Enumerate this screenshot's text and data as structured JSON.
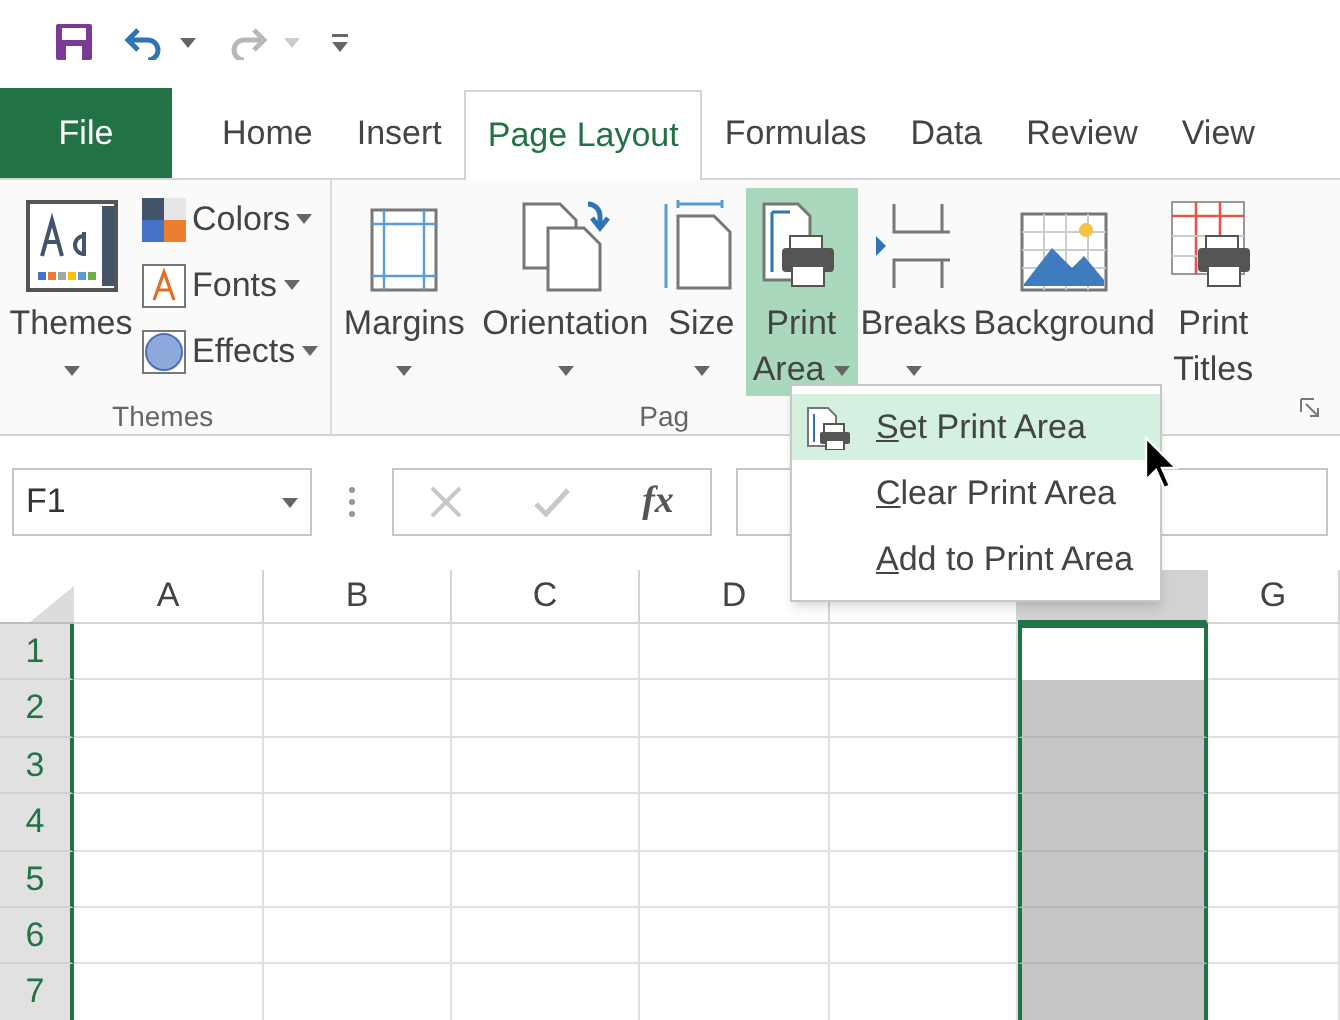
{
  "quick_access": [
    {
      "kind": "save",
      "disabled": false
    },
    {
      "kind": "undo",
      "disabled": false
    },
    {
      "kind": "redo",
      "disabled": true
    },
    {
      "kind": "customize",
      "disabled": false
    }
  ],
  "tabs": [
    {
      "label": "File",
      "kind": "file",
      "selected": false
    },
    {
      "label": "Home",
      "kind": "tab",
      "selected": false
    },
    {
      "label": "Insert",
      "kind": "tab",
      "selected": false
    },
    {
      "label": "Page Layout",
      "kind": "tab",
      "selected": true
    },
    {
      "label": "Formulas",
      "kind": "tab",
      "selected": false
    },
    {
      "label": "Data",
      "kind": "tab",
      "selected": false
    },
    {
      "label": "Review",
      "kind": "tab",
      "selected": false
    },
    {
      "label": "View",
      "kind": "tab",
      "selected": false
    }
  ],
  "ribbon": {
    "groups": [
      {
        "label": "Themes",
        "buttons": [
          {
            "label": "Themes",
            "kind": "large",
            "dropdown": true,
            "selected": false
          },
          {
            "label": "Colors",
            "kind": "small",
            "dropdown": true,
            "selected": false
          },
          {
            "label": "Fonts",
            "kind": "small",
            "dropdown": true,
            "selected": false
          },
          {
            "label": "Effects",
            "kind": "small",
            "dropdown": true,
            "selected": false
          }
        ]
      },
      {
        "label": "Pag",
        "launcher": true,
        "buttons": [
          {
            "label": "Margins",
            "kind": "large",
            "dropdown": true,
            "selected": false
          },
          {
            "label": "Orientation",
            "kind": "large",
            "dropdown": true,
            "selected": false
          },
          {
            "label": "Size",
            "kind": "large",
            "dropdown": true,
            "selected": false
          },
          {
            "label": "Print Area",
            "kind": "large",
            "dropdown": true,
            "selected": true
          },
          {
            "label": "Breaks",
            "kind": "large",
            "dropdown": true,
            "selected": false
          },
          {
            "label": "Background",
            "kind": "large",
            "dropdown": false,
            "selected": false
          },
          {
            "label": "Print Titles",
            "kind": "large",
            "dropdown": false,
            "selected": false
          }
        ]
      }
    ]
  },
  "formula_bar": {
    "name_box": "F1",
    "cancel_disabled": true,
    "enter_disabled": true,
    "function_label": "fx"
  },
  "menu": {
    "items": [
      {
        "label": "Set Print Area",
        "selected": true
      },
      {
        "label": "Clear Print Area",
        "selected": false
      },
      {
        "label": "Add to Print Area",
        "selected": false
      }
    ]
  },
  "sheet": {
    "columns": [
      {
        "label": "A",
        "selected": false
      },
      {
        "label": "B",
        "selected": false
      },
      {
        "label": "C",
        "selected": false
      },
      {
        "label": "D",
        "selected": false
      },
      {
        "selected": false
      },
      {
        "selected": true
      },
      {
        "label": "G",
        "selected": false
      }
    ],
    "rows": [
      {
        "label": "1",
        "selected": true,
        "active": true
      },
      {
        "label": "2",
        "selected": true,
        "active": false
      },
      {
        "label": "3",
        "selected": true,
        "active": false
      },
      {
        "label": "4",
        "selected": true,
        "active": false
      },
      {
        "label": "5",
        "selected": true,
        "active": false
      },
      {
        "label": "6",
        "selected": true,
        "active": false
      },
      {
        "label": "7",
        "selected": true,
        "active": false
      }
    ]
  }
}
